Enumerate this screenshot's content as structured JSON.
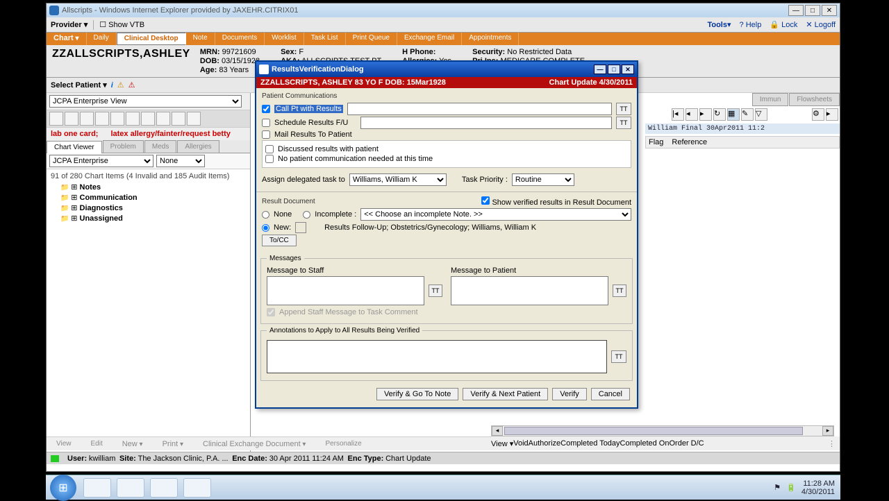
{
  "window": {
    "title": "Allscripts - Windows Internet Explorer provided by JAXEHR.CITRIX01"
  },
  "topbar": {
    "provider_label": "Provider",
    "show_vtb": "Show VTB",
    "tools": "Tools",
    "help": "Help",
    "lock": "Lock",
    "logoff": "Logoff"
  },
  "orange_tabs": {
    "chart": "Chart",
    "items": [
      "Daily",
      "Clinical Desktop",
      "Note",
      "Documents",
      "Worklist",
      "Task List",
      "Print Queue",
      "Exchange Email",
      "Appointments"
    ],
    "selected": 1
  },
  "patient": {
    "name": "ZZALLSCRIPTS,ASHLEY",
    "mrn_l": "MRN:",
    "mrn": "99721609",
    "dob_l": "DOB:",
    "dob": "03/15/1928",
    "age_l": "Age:",
    "age": "83 Years",
    "sex_l": "Sex:",
    "sex": "F",
    "aka_l": "AKA:",
    "aka": "ALLSCRIPTS TEST PT",
    "hphone_l": "H Phone:",
    "allergies_l": "Allergies:",
    "allergies": "Yes",
    "security_l": "Security:",
    "security": "No Restricted Data",
    "priins_l": "Pri Ins:",
    "priins": "MEDICARE COMPLETE"
  },
  "selbar": {
    "select_patient": "Select Patient",
    "view": "JCPA Enterprise View"
  },
  "alerts": {
    "a1": "lab one card;",
    "a2": "latex allergy/fainter/request betty"
  },
  "tabs_left": {
    "items": [
      "Chart Viewer",
      "Problem",
      "Meds",
      "Allergies"
    ],
    "selected": 0
  },
  "tabs_right": {
    "items": [
      "Immun",
      "Flowsheets"
    ]
  },
  "sub": {
    "source": "JCPA Enterprise",
    "filter": "None"
  },
  "tree": {
    "header": "91 of 280 Chart Items (4 Invalid and 185 Audit Items)",
    "items": [
      "Notes",
      "Communication",
      "Diagnostics",
      "Unassigned"
    ]
  },
  "result_row": {
    "text": "William        Final   30Apr2011 11:2",
    "flag": "Flag",
    "reference": "Reference"
  },
  "dialog": {
    "title": "ResultsVerificationDialog",
    "band_left": "ZZALLSCRIPTS, ASHLEY  83 YO  F DOB: 15Mar1928",
    "band_right": "Chart Update  4/30/2011",
    "pc_title": "Patient Communications",
    "call_pt": "Call Pt with Results",
    "schedule": "Schedule Results F/U",
    "mail": "Mail Results To Patient",
    "discussed": "Discussed results with patient",
    "none_needed": "No patient communication needed at this time",
    "assign_label": "Assign delegated task to",
    "assign_value": "Williams, William K",
    "priority_label": "Task Priority :",
    "priority_value": "Routine",
    "rd_title": "Result Document",
    "show_verified": "Show verified results in Result Document",
    "none": "None",
    "incomplete": "Incomplete :",
    "incomplete_choose": "<< Choose an incomplete Note. >>",
    "new": "New:",
    "new_desc": "Results Follow-Up; Obstetrics/Gynecology; Williams, William K",
    "tocc": "To/CC",
    "msgs_title": "Messages",
    "msg_staff": "Message to Staff",
    "msg_patient": "Message to Patient",
    "append": "Append Staff Message to Task Comment",
    "annotations": "Annotations to Apply to All Results Being Verified",
    "tt": "TT",
    "btns": {
      "v_goto": "Verify & Go To Note",
      "v_next": "Verify & Next Patient",
      "verify": "Verify",
      "cancel": "Cancel"
    }
  },
  "bottom_left_menu": [
    "View",
    "Edit",
    "New",
    "Print",
    "Clinical Exchange Document",
    "Personalize"
  ],
  "bottom_right_menu": [
    "View",
    "Void",
    "Authorize",
    "Completed Today",
    "Completed On",
    "Order D/C"
  ],
  "status": {
    "user_l": "User:",
    "user": "kwilliam",
    "site_l": "Site:",
    "site": "The Jackson Clinic, P.A. ...",
    "enc_l": "Enc Date:",
    "enc": "30 Apr 2011 11:24 AM",
    "enct_l": "Enc Type:",
    "enct": "Chart Update"
  },
  "tray": {
    "time": "11:28 AM",
    "date": "4/30/2011"
  }
}
